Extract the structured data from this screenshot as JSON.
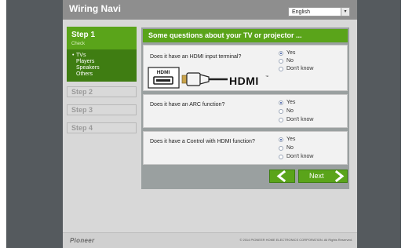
{
  "app": {
    "title": "Wiring Navi",
    "language": "English",
    "language_arrow": "▾"
  },
  "sidebar": {
    "step1": {
      "title": "Step 1",
      "subtitle": "Check",
      "items": [
        "TVs",
        "Players",
        "Speakers",
        "Others"
      ]
    },
    "step2": "Step 2",
    "step3": "Step 3",
    "step4": "Step 4"
  },
  "main": {
    "heading": "Some questions about your TV or projector ...",
    "questions": [
      {
        "text": "Does it have an HDMI input terminal?",
        "options": [
          "Yes",
          "No",
          "Don't know"
        ],
        "selected": "Yes"
      },
      {
        "text": "Does it have an ARC function?",
        "options": [
          "Yes",
          "No",
          "Don't know"
        ],
        "selected": "Yes"
      },
      {
        "text": "Does it have a Control with HDMI function?",
        "options": [
          "Yes",
          "No",
          "Don't know"
        ],
        "selected": "Yes"
      }
    ],
    "hdmi_label": "HDMI",
    "hdmi_logo": "HDMI",
    "hdmi_tm": "™"
  },
  "nav": {
    "next_label": "Next"
  },
  "footer": {
    "logo": "Pioneer",
    "copyright": "© 2014 PIONEER HOME ELECTRONICS CORPORATION. All Rights Reserved."
  },
  "colors": {
    "accent": "#5aa41a",
    "accent_dark": "#3f7d12",
    "radio_on": "#2d4b9a"
  }
}
